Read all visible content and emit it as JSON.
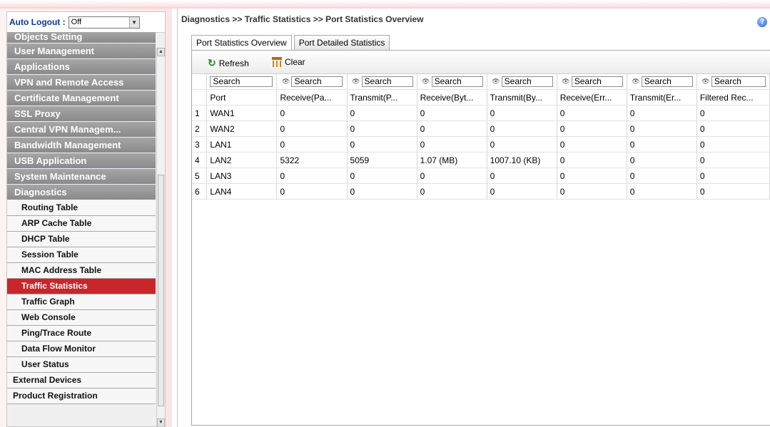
{
  "sidebar": {
    "auto_logout_label": "Auto Logout :",
    "auto_logout_value": "Off",
    "categories": [
      "Objects Setting",
      "User Management",
      "Applications",
      "VPN and Remote Access",
      "Certificate Management",
      "SSL Proxy",
      "Central VPN Managem...",
      "Bandwidth Management",
      "USB Application",
      "System Maintenance",
      "Diagnostics"
    ],
    "diagnostics_items": [
      "Routing Table",
      "ARP Cache Table",
      "DHCP Table",
      "Session Table",
      "MAC Address Table",
      "Traffic Statistics",
      "Traffic Graph",
      "Web Console",
      "Ping/Trace Route",
      "Data Flow Monitor",
      "User Status"
    ],
    "active_item": "Traffic Statistics",
    "bottom_items": [
      "External Devices",
      "Product Registration"
    ]
  },
  "header": {
    "breadcrumb": "Diagnostics >> Traffic Statistics >> Port Statistics Overview",
    "help_glyph": "?"
  },
  "tabs": [
    {
      "label": "Port Statistics Overview",
      "active": true
    },
    {
      "label": "Port Detailed Statistics",
      "active": false
    }
  ],
  "toolbar": {
    "refresh_label": "Refresh",
    "clear_label": "Clear"
  },
  "table": {
    "search_placeholder": "Search",
    "columns": [
      "Port",
      "Receive(Pa...",
      "Transmit(P...",
      "Receive(Byt...",
      "Transmit(By...",
      "Receive(Err...",
      "Transmit(Er...",
      "Filtered Rec..."
    ],
    "rows": [
      [
        "1",
        "WAN1",
        "0",
        "0",
        "0",
        "0",
        "0",
        "0",
        "0"
      ],
      [
        "2",
        "WAN2",
        "0",
        "0",
        "0",
        "0",
        "0",
        "0",
        "0"
      ],
      [
        "3",
        "LAN1",
        "0",
        "0",
        "0",
        "0",
        "0",
        "0",
        "0"
      ],
      [
        "4",
        "LAN2",
        "5322",
        "5059",
        "1.07 (MB)",
        "1007.10 (KB)",
        "0",
        "0",
        "0"
      ],
      [
        "5",
        "LAN3",
        "0",
        "0",
        "0",
        "0",
        "0",
        "0",
        "0"
      ],
      [
        "6",
        "LAN4",
        "0",
        "0",
        "0",
        "0",
        "0",
        "0",
        "0"
      ]
    ]
  }
}
